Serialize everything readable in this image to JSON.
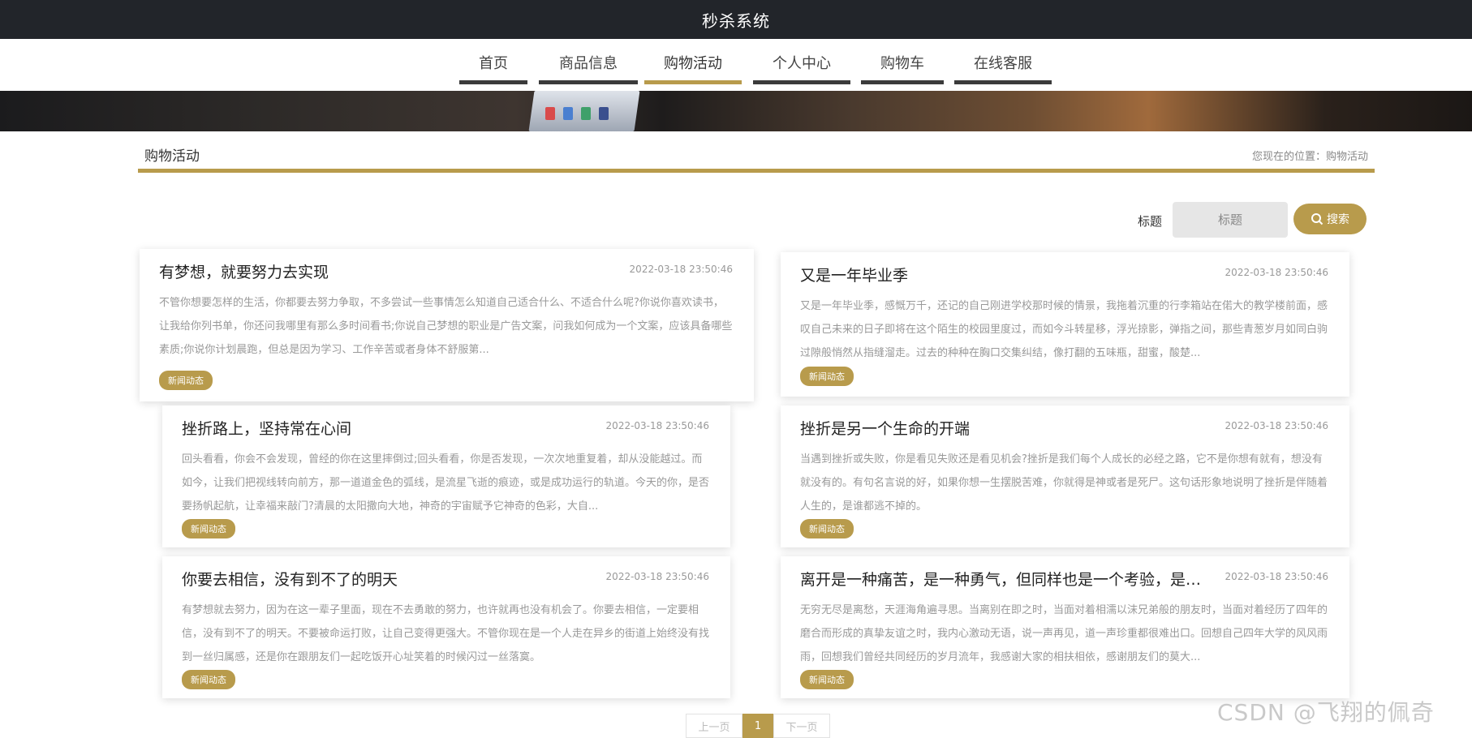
{
  "header": {
    "title": "秒杀系统"
  },
  "nav": {
    "items": [
      {
        "label": "首页"
      },
      {
        "label": "商品信息"
      },
      {
        "label": "购物活动"
      },
      {
        "label": "个人中心"
      },
      {
        "label": "购物车"
      },
      {
        "label": "在线客服"
      }
    ],
    "active": "购物活动"
  },
  "section": {
    "title": "购物活动",
    "breadcrumb": "您现在的位置：购物活动"
  },
  "search": {
    "label": "标题",
    "placeholder": "标题",
    "button_label": "搜索"
  },
  "articles": [
    {
      "title": "有梦想，就要努力去实现",
      "date": "2022-03-18 23:50:46",
      "summary": "不管你想要怎样的生活，你都要去努力争取，不多尝试一些事情怎么知道自己适合什么、不适合什么呢?你说你喜欢读书，让我给你列书单，你还问我哪里有那么多时间看书;你说自己梦想的职业是广告文案，问我如何成为一个文案，应该具备哪些素质;你说你计划晨跑，但总是因为学习、工作辛苦或者身体不舒服第...",
      "tag": "新闻动态"
    },
    {
      "title": "又是一年毕业季",
      "date": "2022-03-18 23:50:46",
      "summary": "又是一年毕业季，感慨万千，还记的自己刚进学校那时候的情景，我拖着沉重的行李箱站在偌大的教学楼前面，感叹自己未来的日子即将在这个陌生的校园里度过，而如今斗转星移，浮光掠影，弹指之间，那些青葱岁月如同白驹过隙般悄然从指缝溜走。过去的种种在胸口交集纠结，像打翻的五味瓶，甜蜜，酸楚...",
      "tag": "新闻动态"
    },
    {
      "title": "挫折路上，坚持常在心间",
      "date": "2022-03-18 23:50:46",
      "summary": "回头看看，你会不会发现，曾经的你在这里摔倒过;回头看看，你是否发现，一次次地重复着，却从没能越过。而如今，让我们把视线转向前方，那一道道金色的弧线，是流星飞逝的痕迹，或是成功运行的轨道。今天的你，是否要扬帆起航，让幸福来敲门?清晨的太阳撒向大地，神奇的宇宙赋予它神奇的色彩，大自...",
      "tag": "新闻动态"
    },
    {
      "title": "挫折是另一个生命的开端",
      "date": "2022-03-18 23:50:46",
      "summary": "当遇到挫折或失败，你是看见失败还是看见机会?挫折是我们每个人成长的必经之路，它不是你想有就有，想没有就没有的。有句名言说的好，如果你想一生摆脱苦难，你就得是神或者是死尸。这句话形象地说明了挫折是伴随着人生的，是谁都逃不掉的。",
      "tag": "新闻动态"
    },
    {
      "title": "你要去相信，没有到不了的明天",
      "date": "2022-03-18 23:50:46",
      "summary": "有梦想就去努力，因为在这一辈子里面，现在不去勇敢的努力，也许就再也没有机会了。你要去相信，一定要相信，没有到不了的明天。不要被命运打败，让自己变得更强大。不管你现在是一个人走在异乡的街道上始终没有找到一丝归属感，还是你在跟朋友们一起吃饭开心址笑着的时候闪过一丝落寞。",
      "tag": "新闻动态"
    },
    {
      "title": "离开是一种痛苦，是一种勇气，但同样也是一个考验，是一个新的开始",
      "date": "2022-03-18 23:50:46",
      "summary": "无穷无尽是离愁，天涯海角遍寻思。当离别在即之时，当面对着相濡以沫兄弟般的朋友时，当面对着经历了四年的磨合而形成的真挚友谊之时，我内心激动无语，说一声再见，道一声珍重都很难出口。回想自己四年大学的风风雨雨，回想我们曾经共同经历的岁月流年，我感谢大家的相扶相依，感谢朋友们的莫大...",
      "tag": "新闻动态"
    }
  ],
  "pagination": {
    "prev": "上一页",
    "current": "1",
    "next": "下一页"
  },
  "watermark": "CSDN @飞翔的佩奇"
}
